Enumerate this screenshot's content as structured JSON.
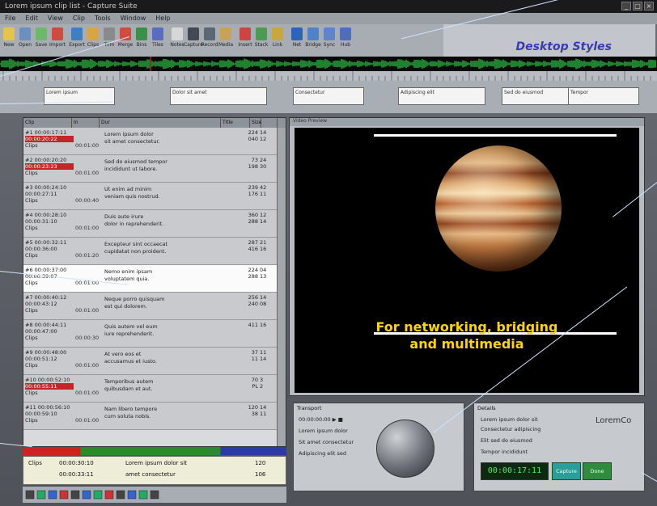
{
  "window": {
    "title": "Lorem ipsum clip list - Capture Suite",
    "min": "_",
    "max": "□",
    "close": "×"
  },
  "menu": [
    "File",
    "Edit",
    "View",
    "Clip",
    "Tools",
    "Window",
    "Help"
  ],
  "toolbar": {
    "buttons": [
      {
        "label": "New",
        "color": "#e2c54a"
      },
      {
        "label": "Open",
        "color": "#6b8fbf"
      },
      {
        "label": "Save",
        "color": "#6db86b"
      },
      {
        "label": "Import",
        "color": "#cf4b3f"
      },
      {
        "label": "Export",
        "color": "#3f7fbd"
      },
      {
        "label": "Clips",
        "color": "#d9a53e"
      },
      {
        "label": "Trim",
        "color": "#8a8a8a"
      },
      {
        "label": "Merge",
        "color": "#d24b3f"
      },
      {
        "label": "Bins",
        "color": "#3c8e4a"
      },
      {
        "label": "Tiles",
        "color": "#5a6cc0"
      },
      {
        "label": "Notes",
        "color": "#d7d7d7"
      },
      {
        "label": "Capture",
        "color": "#444a55"
      },
      {
        "label": "Record",
        "color": "#5d6773"
      },
      {
        "label": "Media",
        "color": "#c9a25a"
      },
      {
        "label": "Insert",
        "color": "#c44"
      },
      {
        "label": "Stack",
        "color": "#4d9a52"
      },
      {
        "label": "Link",
        "color": "#c8a640"
      },
      {
        "label": "Net",
        "color": "#2f63b5"
      },
      {
        "label": "Bridge",
        "color": "#4f82c7"
      },
      {
        "label": "Sync",
        "color": "#5f84c8"
      },
      {
        "label": "Hub",
        "color": "#4e6fb8"
      }
    ]
  },
  "styles": {
    "title": "Desktop Styles"
  },
  "cues": [
    "Lorem ipsum",
    "Dolor sit amet",
    "Consectetur",
    "Adipiscing elit",
    "Sed do eiusmod",
    "Tempor"
  ],
  "list": {
    "headers": [
      "Clip",
      "In",
      "Dur",
      "Title",
      "Size",
      ""
    ],
    "rows": [
      {
        "a": "#1 00:00:17:11",
        "b": "00:00:20:22",
        "c": "Clips",
        "dur": "00:01:00",
        "title": "Lorem ipsum dolor",
        "title2": "sit amet consectetur.",
        "n1": "224",
        "n2": "040",
        "s1": "14",
        "s2": "12",
        "red": true,
        "sel": false
      },
      {
        "a": "#2 00:00:20:20",
        "b": "00:00:23:23",
        "c": "Clips",
        "dur": "00:01:00",
        "title": "Sed do eiusmod tempor",
        "title2": "incididunt ut labore.",
        "n1": "73",
        "n2": "198",
        "s1": "24",
        "s2": "30",
        "red": true,
        "sel": false
      },
      {
        "a": "#3 00:00:24:10",
        "b": "00:00:27:11",
        "c": "Clips",
        "dur": "00:00:40",
        "title": "Ut enim ad minim",
        "title2": "veniam quis nostrud.",
        "n1": "239",
        "n2": "176",
        "s1": "42",
        "s2": "11",
        "red": false,
        "sel": false
      },
      {
        "a": "#4 00:00:28:10",
        "b": "00:00:31:10",
        "c": "Clips",
        "dur": "00:01:00",
        "title": "Duis aute irure",
        "title2": "dolor in reprehenderit.",
        "n1": "360",
        "n2": "288",
        "s1": "12",
        "s2": "14",
        "red": false,
        "sel": false
      },
      {
        "a": "#5 00:00:32:11",
        "b": "00:00:36:00",
        "c": "Clips",
        "dur": "00:01:20",
        "title": "Excepteur sint occaecat",
        "title2": "cupidatat non proident.",
        "n1": "287",
        "n2": "416",
        "s1": "21",
        "s2": "16",
        "red": false,
        "sel": false
      },
      {
        "a": "#6 00:00:37:00",
        "b": "00:00:39:07",
        "c": "Clips",
        "dur": "00:01:00",
        "title": "Nemo enim ipsam",
        "title2": "voluptatem quia.",
        "n1": "224",
        "n2": "288",
        "s1": "04",
        "s2": "13",
        "red": false,
        "sel": true
      },
      {
        "a": "#7 00:00:40:12",
        "b": "00:00:43:12",
        "c": "Clips",
        "dur": "00:01:00",
        "title": "Neque porro quisquam",
        "title2": "est qui dolorem.",
        "n1": "256",
        "n2": "240",
        "s1": "14",
        "s2": "08",
        "red": false,
        "sel": false
      },
      {
        "a": "#8 00:00:44:11",
        "b": "00:00:47:00",
        "c": "Clips",
        "dur": "00:00:30",
        "title": "Quis autem vel eum",
        "title2": "iure reprehenderit.",
        "n1": "411",
        "n2": "",
        "s1": "16",
        "s2": "",
        "red": false,
        "sel": false
      },
      {
        "a": "#9 00:00:48:00",
        "b": "00:00:51:12",
        "c": "Clips",
        "dur": "00:01:00",
        "title": "At vero eos et",
        "title2": "accusamus et iusto.",
        "n1": "37",
        "n2": "11",
        "s1": "11",
        "s2": "14",
        "red": false,
        "sel": false
      },
      {
        "a": "#10 00:00:52:10",
        "b": "00:00:55:11",
        "c": "Clips",
        "dur": "00:01:00",
        "title": "Temporibus autem",
        "title2": "quibusdam et aut.",
        "n1": "70",
        "n2": "PL",
        "s1": "3",
        "s2": "2",
        "red": true,
        "sel": false
      },
      {
        "a": "#11 00:00:56:10",
        "b": "00:00:59:10",
        "c": "Clips",
        "dur": "00:01:00",
        "title": "Nam libero tempore",
        "title2": "cum soluta nobis.",
        "n1": "120",
        "n2": "38",
        "s1": "14",
        "s2": "11",
        "red": false,
        "sel": false
      }
    ]
  },
  "preview": {
    "clip": "Clips",
    "tc1": "00:00:30:10",
    "tc2": "00:00:33:11",
    "line1": "Lorem ipsum dolor sit",
    "line2": "amet consectetur",
    "n1": "120",
    "n2": "106"
  },
  "video": {
    "panel_title": "Video Preview",
    "caption": "For networking, bridging\nand multimedia"
  },
  "controls": {
    "title": "Transport",
    "lines": [
      "00:00:00:00  ▶  ■",
      "Lorem ipsum dolor",
      "Sit amet  consectetur",
      "Adipiscing elit sed"
    ]
  },
  "info": {
    "title": "Details",
    "lines": [
      "Lorem ipsum  dolor sit",
      "Consectetur  adipiscing",
      "Elit sed do   eiusmod",
      "Tempor  incididunt"
    ],
    "logo": "LoremCo",
    "timecode": "00:00:17:11",
    "btn1": "Capture",
    "btn2": "Done"
  },
  "colors": {
    "waveform": "#2fd14a",
    "accent_title": "#3b3bb0",
    "caption": "#ffd21a"
  }
}
